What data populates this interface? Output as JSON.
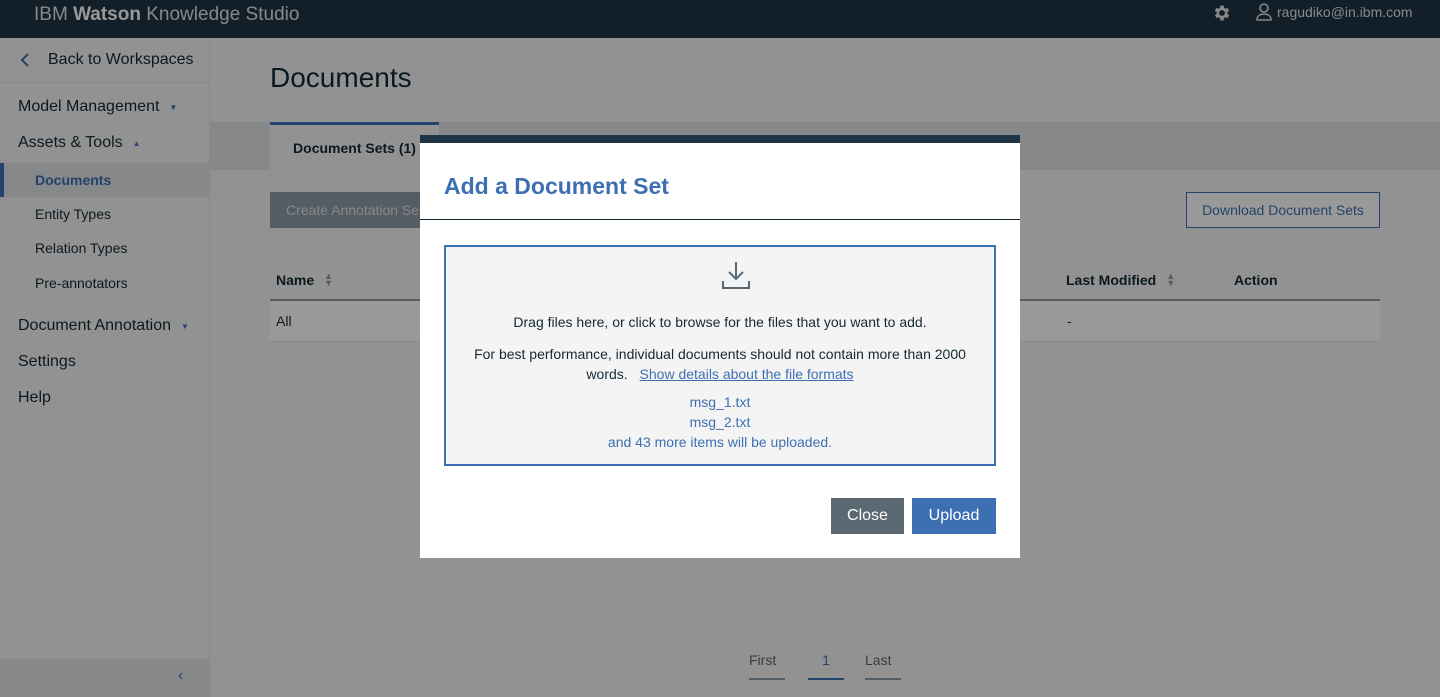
{
  "app": {
    "brand_prefix": "IBM",
    "brand_bold": "Watson",
    "brand_suffix": "Knowledge Studio",
    "user_email": "ragudiko@in.ibm.com"
  },
  "sidebar": {
    "back_label": "Back to Workspaces",
    "sections": {
      "model_management": "Model Management",
      "assets_tools": "Assets & Tools",
      "document_annotation": "Document Annotation",
      "settings": "Settings",
      "help": "Help"
    },
    "assets_items": [
      "Documents",
      "Entity Types",
      "Relation Types",
      "Pre-annotators"
    ],
    "active_item": "Documents"
  },
  "main": {
    "page_title": "Documents",
    "tab_document_sets": "Document Sets (1)",
    "btn_create_annotation": "Create Annotation Sets",
    "btn_download": "Download Document Sets",
    "table": {
      "columns": [
        "Name",
        "Last Modified",
        "Action"
      ],
      "rows": [
        {
          "name": "All",
          "last_modified": "-",
          "action": ""
        }
      ]
    },
    "pagination": {
      "first": "First",
      "current": "1",
      "last": "Last"
    }
  },
  "modal": {
    "title": "Add a Document Set",
    "drop_instruction": "Drag files here, or click to browse for the files that you want to add.",
    "perf_note": "For best performance, individual documents should not contain more than 2000 words.",
    "details_link": "Show details about the file formats",
    "files": [
      "msg_1.txt",
      "msg_2.txt"
    ],
    "more_items": "and 43 more items will be uploaded.",
    "close_label": "Close",
    "upload_label": "Upload"
  },
  "colors": {
    "header_bg": "#1f3445",
    "accent": "#3d70b2",
    "close_btn": "#5a6872"
  }
}
